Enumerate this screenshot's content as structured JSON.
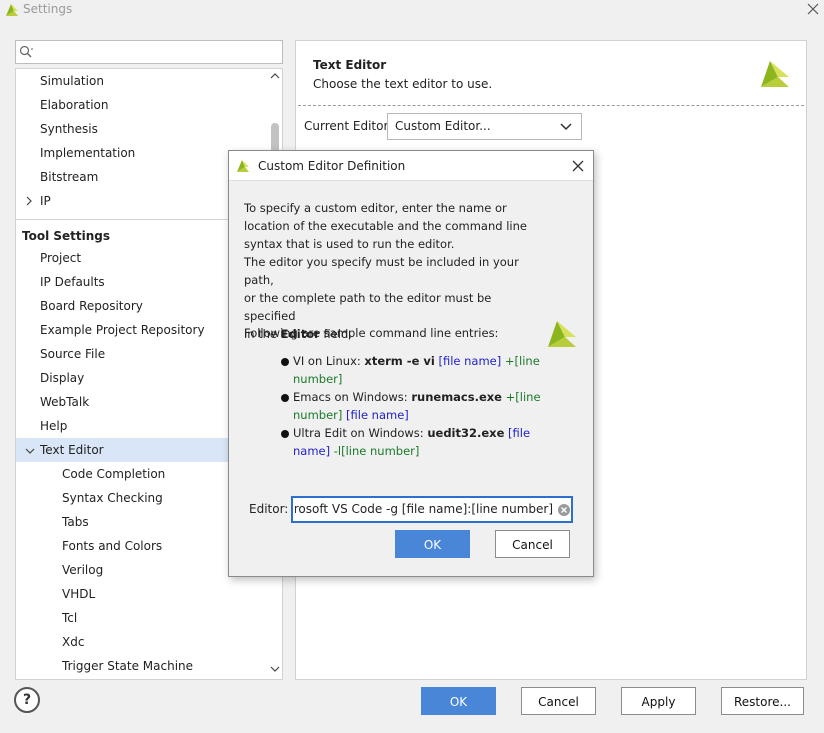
{
  "window": {
    "title": "Settings"
  },
  "search": {
    "placeholder": ""
  },
  "tree": {
    "items": [
      {
        "label": "Simulation"
      },
      {
        "label": "Elaboration"
      },
      {
        "label": "Synthesis"
      },
      {
        "label": "Implementation"
      },
      {
        "label": "Bitstream"
      },
      {
        "label": "IP"
      }
    ],
    "tool_settings_header": "Tool Settings",
    "tool_items": [
      {
        "label": "Project"
      },
      {
        "label": "IP Defaults"
      },
      {
        "label": "Board Repository"
      },
      {
        "label": "Example Project Repository"
      },
      {
        "label": "Source File"
      },
      {
        "label": "Display"
      },
      {
        "label": "WebTalk"
      },
      {
        "label": "Help"
      },
      {
        "label": "Text Editor"
      }
    ],
    "text_editor_children": [
      {
        "label": "Code Completion"
      },
      {
        "label": "Syntax Checking"
      },
      {
        "label": "Tabs"
      },
      {
        "label": "Fonts and Colors"
      },
      {
        "label": "Verilog"
      },
      {
        "label": "VHDL"
      },
      {
        "label": "Tcl"
      },
      {
        "label": "Xdc"
      },
      {
        "label": "Trigger State Machine"
      }
    ]
  },
  "panel": {
    "title": "Text Editor",
    "subtitle": "Choose the text editor to use.",
    "current_editor_label": "Current Editor:",
    "current_editor_value": "Custom Editor..."
  },
  "dialog": {
    "title": "Custom Editor Definition",
    "para1": [
      "To specify a custom editor, enter the name or",
      "location of the executable and the command line",
      "syntax that is used to run the editor.",
      "The editor you specify must be included in your path,",
      "or the complete path to the editor must be specified"
    ],
    "para1_last_prefix": "in the ",
    "para1_last_bold": "Editor",
    "para1_last_suffix": " field.",
    "samples_heading": "Following are sample command line entries:",
    "samples": [
      {
        "prefix": "VI on Linux: ",
        "cmd": "xterm -e vi",
        "arg1": " [file name]",
        "arg2": " +[line",
        "arg2b": "number]"
      },
      {
        "prefix": "Emacs on Windows: ",
        "cmd": "runemacs.exe",
        "arg1": " +[line",
        "arg1b": "number]",
        "arg2": " [file name]"
      },
      {
        "prefix": "Ultra Edit on Windows: ",
        "cmd": "uedit32.exe",
        "arg1": " [file",
        "arg1b": "name]",
        "arg2": " -l[line number]"
      }
    ],
    "editor_label": "Editor:",
    "editor_value": "Microsoft VS Code -g [file name]:[line number]",
    "ok_label": "OK",
    "cancel_label": "Cancel"
  },
  "footer": {
    "help_label": "?",
    "ok_label": "OK",
    "cancel_label": "Cancel",
    "apply_label": "Apply",
    "restore_label": "Restore..."
  },
  "colors": {
    "accent": "#4a86d8",
    "selection": "#d8e6f7",
    "logo_green": "#8cb61e",
    "logo_yellow": "#d7e25a"
  }
}
